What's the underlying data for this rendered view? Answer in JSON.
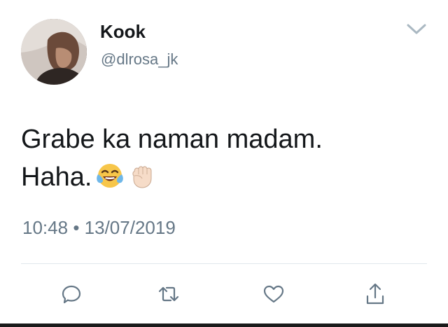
{
  "user": {
    "display_name": "Kook",
    "handle": "@dlrosa_jk",
    "avatar_icon": "profile-photo"
  },
  "tweet": {
    "line1": "Grabe ka naman madam.",
    "line2": "Haha.",
    "emojis": [
      "face-with-tears-of-joy",
      "raised-fist-light-skin-tone"
    ],
    "time": "10:48",
    "separator": "•",
    "date": "13/07/2019"
  },
  "actions": [
    {
      "name": "reply",
      "icon": "speech-bubble-icon"
    },
    {
      "name": "retweet",
      "icon": "retweet-icon"
    },
    {
      "name": "like",
      "icon": "heart-icon"
    },
    {
      "name": "share",
      "icon": "share-icon"
    }
  ],
  "colors": {
    "text": "#14171a",
    "secondary": "#657786",
    "divider": "#e1e8ed",
    "emoji_yellow": "#f7c64a",
    "tear_blue": "#6fb7e8"
  }
}
